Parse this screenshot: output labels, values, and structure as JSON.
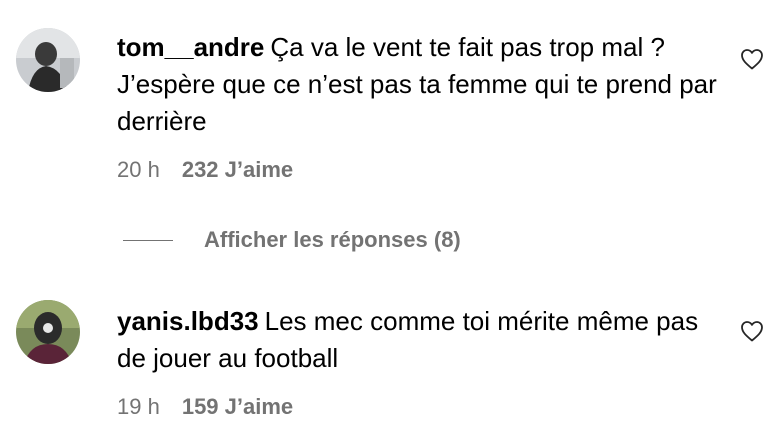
{
  "comments": [
    {
      "username": "tom__andre",
      "text": "Ça va le vent te fait pas trop mal ? J’espère que ce n’est pas ta femme qui te prend par derrière",
      "time": "20 h",
      "likes": "232 J’aime",
      "avatar_icon": "avatar-photo",
      "like_icon": "heart-outline-icon"
    },
    {
      "username": "yanis.lbd33",
      "text": "Les mec comme toi mérite même pas de jouer au football",
      "time": "19 h",
      "likes": "159 J’aime",
      "avatar_icon": "avatar-photo",
      "like_icon": "heart-outline-icon"
    }
  ],
  "replies": {
    "label": "Afficher les réponses (8)"
  },
  "colors": {
    "text": "#000000",
    "secondary": "#737373",
    "background": "#ffffff"
  }
}
